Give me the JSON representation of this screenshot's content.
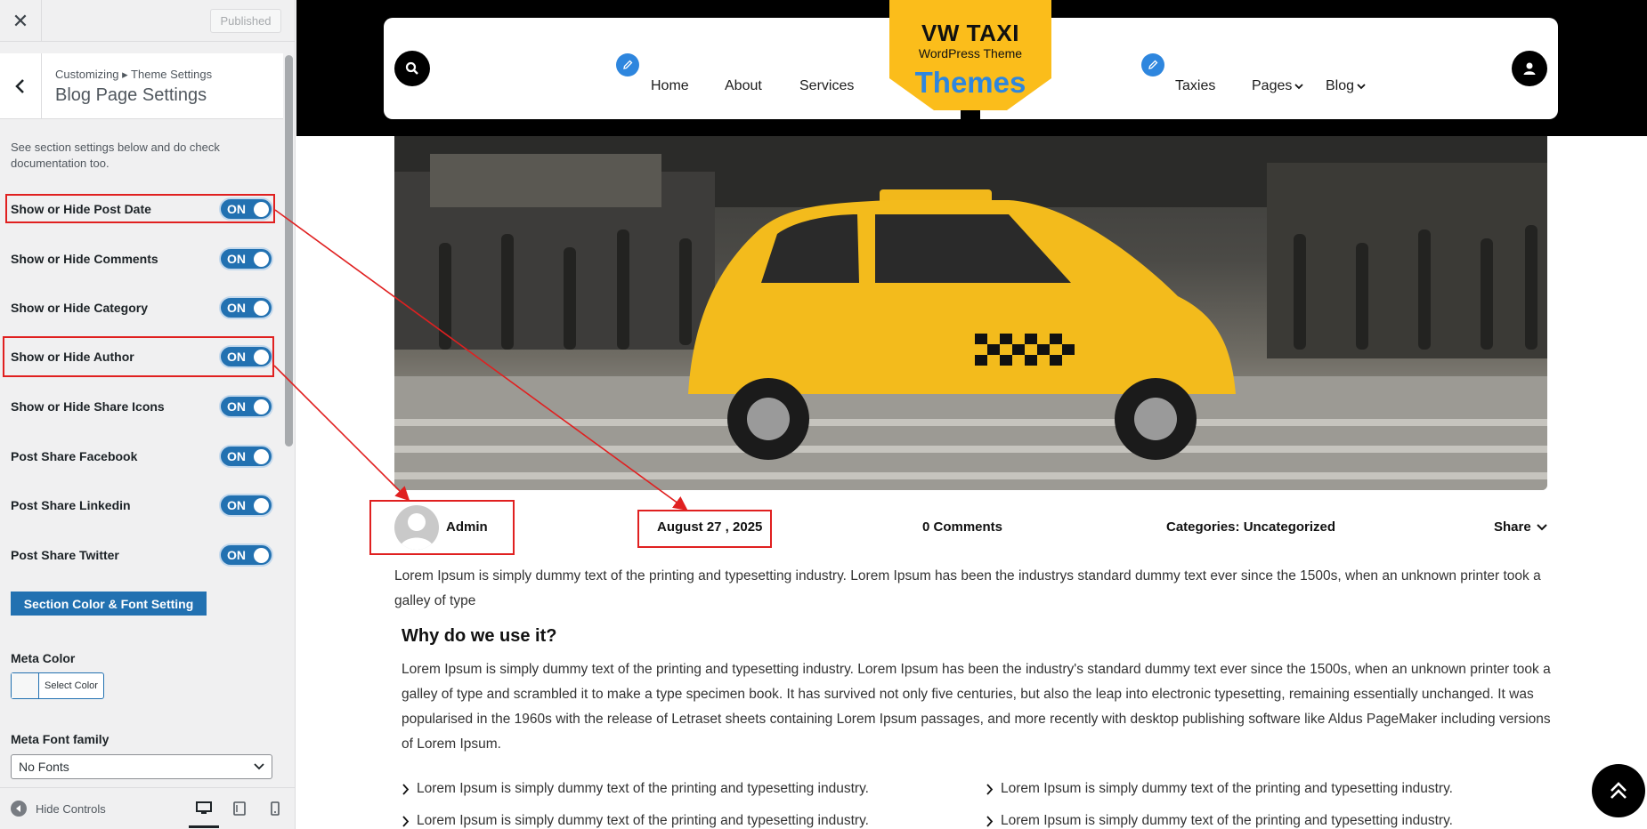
{
  "customizer": {
    "close_symbol": "✕",
    "publish_label": "Published",
    "breadcrumb": "Customizing ▸ Theme Settings",
    "section_title": "Blog Page Settings",
    "description": "See section settings below and do check documentation too.",
    "toggle_on_text": "ON",
    "toggles": [
      {
        "label": "Show or Hide Post Date",
        "state": "ON"
      },
      {
        "label": "Show or Hide Comments",
        "state": "ON"
      },
      {
        "label": "Show or Hide Category",
        "state": "ON"
      },
      {
        "label": "Show or Hide Author",
        "state": "ON"
      },
      {
        "label": "Show or Hide Share Icons",
        "state": "ON"
      },
      {
        "label": "Post Share Facebook",
        "state": "ON"
      },
      {
        "label": "Post Share Linkedin",
        "state": "ON"
      },
      {
        "label": "Post Share Twitter",
        "state": "ON"
      }
    ],
    "section_button": "Section Color & Font Setting",
    "meta_color_label": "Meta Color",
    "select_color_label": "Select Color",
    "meta_font_label": "Meta Font family",
    "meta_font_value": "No Fonts",
    "hide_controls": "Hide Controls",
    "accent_color": "#2271b1",
    "highlight_color": "#e02020"
  },
  "site": {
    "nav_left": [
      "Home",
      "About",
      "Services"
    ],
    "nav_right": [
      "Taxies",
      "Pages",
      "Blog"
    ],
    "logo": {
      "line1": "VW TAXI",
      "line2": "WordPress Theme",
      "line3": "Themes"
    },
    "logo_bg": "#fbbd1b",
    "brand_blue": "#2e86de"
  },
  "post": {
    "author": "Admin",
    "date": "August 27 , 2025",
    "comments": "0 Comments",
    "categories": "Categories: Uncategorized",
    "share": "Share",
    "intro": "Lorem Ipsum is simply dummy text of the printing and typesetting industry. Lorem Ipsum has been the industrys standard dummy text ever since the 1500s, when an unknown printer took a galley of type",
    "heading": "Why do we use it?",
    "body": "Lorem Ipsum is simply dummy text of the printing and typesetting industry. Lorem Ipsum has been the industry's standard dummy text ever since the 1500s, when an unknown printer took a galley of type and scrambled it to make a type specimen book. It has survived not only five centuries, but also the leap into electronic typesetting, remaining essentially unchanged. It was popularised in the 1960s with the release of Letraset sheets containing Lorem Ipsum passages, and more recently with desktop publishing software like Aldus PageMaker including versions of Lorem Ipsum.",
    "bullets": [
      "Lorem Ipsum is simply dummy text of the printing and typesetting industry.",
      "Lorem Ipsum is simply dummy text of the printing and typesetting industry.",
      "Lorem Ipsum is simply dummy text of the printing and typesetting industry.",
      "Lorem Ipsum is simply dummy text of the printing and typesetting industry."
    ]
  }
}
